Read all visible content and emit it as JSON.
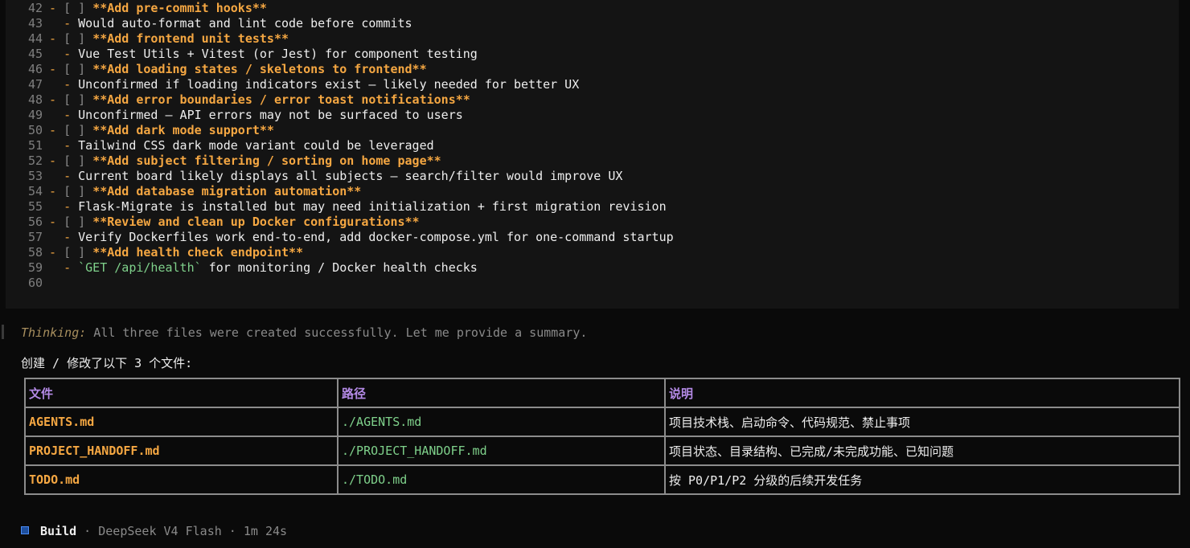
{
  "code": {
    "lines": [
      {
        "num": "42",
        "kind": "task",
        "text": "**Add pre-commit hooks**"
      },
      {
        "num": "43",
        "kind": "sub",
        "text": "Would auto-format and lint code before commits"
      },
      {
        "num": "44",
        "kind": "task",
        "text": "**Add frontend unit tests**"
      },
      {
        "num": "45",
        "kind": "sub",
        "text": "Vue Test Utils + Vitest (or Jest) for component testing"
      },
      {
        "num": "46",
        "kind": "task",
        "text": "**Add loading states / skeletons to frontend**"
      },
      {
        "num": "47",
        "kind": "sub",
        "text": "Unconfirmed if loading indicators exist — likely needed for better UX"
      },
      {
        "num": "48",
        "kind": "task",
        "text": "**Add error boundaries / error toast notifications**"
      },
      {
        "num": "49",
        "kind": "sub",
        "text": "Unconfirmed — API errors may not be surfaced to users"
      },
      {
        "num": "50",
        "kind": "task",
        "text": "**Add dark mode support**"
      },
      {
        "num": "51",
        "kind": "sub",
        "text": "Tailwind CSS dark mode variant could be leveraged"
      },
      {
        "num": "52",
        "kind": "task",
        "text": "**Add subject filtering / sorting on home page**"
      },
      {
        "num": "53",
        "kind": "sub",
        "text": "Current board likely displays all subjects — search/filter would improve UX"
      },
      {
        "num": "54",
        "kind": "task",
        "text": "**Add database migration automation**"
      },
      {
        "num": "55",
        "kind": "sub",
        "text": "Flask-Migrate is installed but may need initialization + first migration revision"
      },
      {
        "num": "56",
        "kind": "task",
        "text": "**Review and clean up Docker configurations**"
      },
      {
        "num": "57",
        "kind": "sub",
        "text": "Verify Dockerfiles work end-to-end, add docker-compose.yml for one-command startup"
      },
      {
        "num": "58",
        "kind": "task",
        "text": "**Add health check endpoint**"
      },
      {
        "num": "59",
        "kind": "sub-code",
        "code": "`GET /api/health`",
        "text": " for monitoring / Docker health checks"
      },
      {
        "num": "60",
        "kind": "empty",
        "text": ""
      }
    ],
    "dash": "-",
    "checkbox": "[ ]"
  },
  "thinking": {
    "label": "Thinking:",
    "text": " All three files were created successfully. Let me provide a summary."
  },
  "summary_text": "创建 / 修改了以下 3 个文件:",
  "table": {
    "headers": [
      "文件",
      "路径",
      "说明"
    ],
    "rows": [
      [
        "AGENTS.md",
        "./AGENTS.md",
        "项目技术栈、启动命令、代码规范、禁止事项"
      ],
      [
        "PROJECT_HANDOFF.md",
        "./PROJECT_HANDOFF.md",
        "项目状态、目录结构、已完成/未完成功能、已知问题"
      ],
      [
        "TODO.md",
        "./TODO.md",
        "按 P0/P1/P2 分级的后续开发任务"
      ]
    ]
  },
  "footer": {
    "build": "Build",
    "model": " · DeepSeek V4 Flash · 1m 24s"
  }
}
